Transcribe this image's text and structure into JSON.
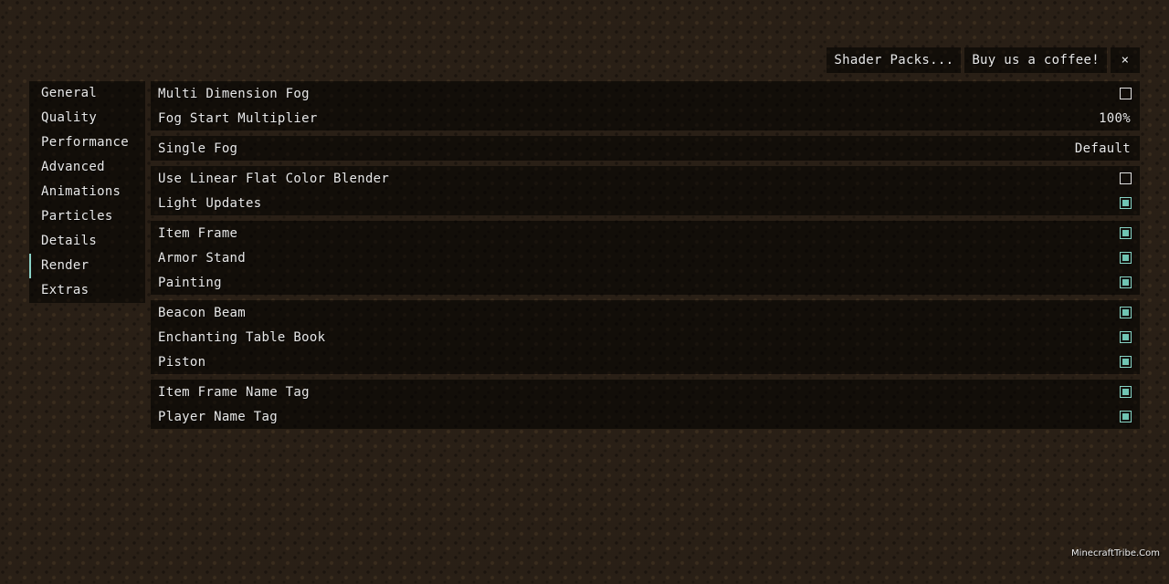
{
  "topbar": {
    "shader_packs": "Shader Packs...",
    "coffee": "Buy us a coffee!",
    "close": "×"
  },
  "sidebar": {
    "items": [
      {
        "label": "General"
      },
      {
        "label": "Quality"
      },
      {
        "label": "Performance"
      },
      {
        "label": "Advanced"
      },
      {
        "label": "Animations"
      },
      {
        "label": "Particles"
      },
      {
        "label": "Details"
      },
      {
        "label": "Render",
        "active": true
      },
      {
        "label": "Extras"
      }
    ]
  },
  "groups": [
    {
      "rows": [
        {
          "label": "Multi Dimension Fog",
          "type": "checkbox",
          "checked": false
        },
        {
          "label": "Fog Start Multiplier",
          "type": "value",
          "value": "100%"
        }
      ]
    },
    {
      "rows": [
        {
          "label": "Single Fog",
          "type": "value",
          "value": "Default"
        }
      ]
    },
    {
      "rows": [
        {
          "label": "Use Linear Flat Color Blender",
          "type": "checkbox",
          "checked": false
        },
        {
          "label": "Light Updates",
          "type": "checkbox",
          "checked": true
        }
      ]
    },
    {
      "rows": [
        {
          "label": "Item Frame",
          "type": "checkbox",
          "checked": true
        },
        {
          "label": "Armor Stand",
          "type": "checkbox",
          "checked": true
        },
        {
          "label": "Painting",
          "type": "checkbox",
          "checked": true
        }
      ]
    },
    {
      "rows": [
        {
          "label": "Beacon Beam",
          "type": "checkbox",
          "checked": true
        },
        {
          "label": "Enchanting Table Book",
          "type": "checkbox",
          "checked": true
        },
        {
          "label": "Piston",
          "type": "checkbox",
          "checked": true
        }
      ]
    },
    {
      "rows": [
        {
          "label": "Item Frame Name Tag",
          "type": "checkbox",
          "checked": true
        },
        {
          "label": "Player Name Tag",
          "type": "checkbox",
          "checked": true
        }
      ]
    }
  ],
  "colors": {
    "accent": "#6fc4b3",
    "panel": "#000000"
  },
  "watermark": "MinecraftTribe.Com"
}
